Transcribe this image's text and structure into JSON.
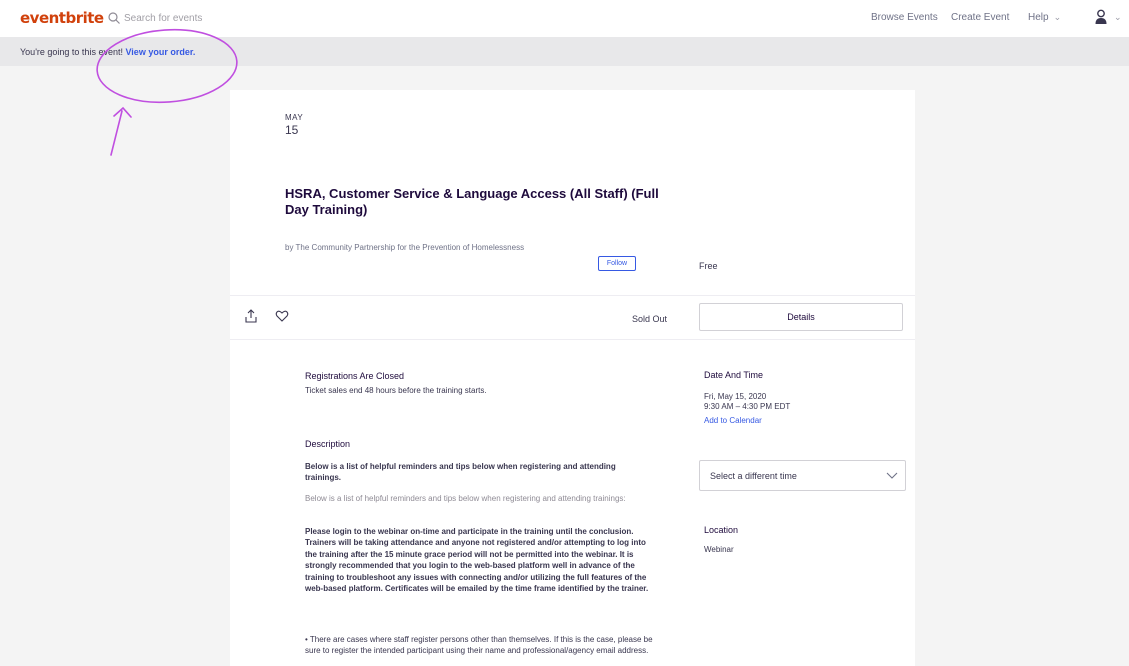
{
  "header": {
    "logo": "eventbrite",
    "search_placeholder": "Search for events",
    "nav": {
      "browse": "Browse Events",
      "create": "Create Event",
      "help": "Help"
    },
    "chevron": "⌄"
  },
  "banner": {
    "text": "You're going to this event! ",
    "link": "View your order."
  },
  "event": {
    "month": "MAY",
    "day": "15",
    "title": "HSRA, Customer Service & Language Access (All Staff) (Full Day Training)",
    "organizer": "by The Community Partnership for the Prevention of Homelessness",
    "follow_label": "Follow",
    "price": "Free"
  },
  "actions": {
    "sold_out": "Sold Out",
    "details_label": "Details"
  },
  "registration": {
    "heading": "Registrations Are Closed",
    "text": "Ticket sales end 48 hours before the training starts."
  },
  "description": {
    "heading": "Description",
    "summary": "Below is a list of helpful reminders and tips below when registering and attending trainings.",
    "summary_repeat": "Below is a list of helpful reminders and tips below when registering and attending trainings:",
    "paragraph": "Please login to the webinar on-time and participate in the training until the conclusion. Trainers will be taking attendance and anyone not registered and/or attempting to log into the training after the 15 minute grace period will not be permitted into the webinar. It is strongly recommended that you login to the web-based platform well in advance of the training to troubleshoot any issues with connecting and/or utilizing the full features of the web-based platform. Certificates will be emailed by the time frame identified by the trainer.",
    "bullet": "• There are cases where staff register persons other than themselves. If this is the case, please be sure to register the intended participant using their name and professional/agency email address."
  },
  "date_time": {
    "heading": "Date And Time",
    "date": "Fri, May 15, 2020",
    "time": "9:30 AM – 4:30 PM EDT",
    "add_calendar": "Add to Calendar",
    "select_label": "Select a different time"
  },
  "location": {
    "heading": "Location",
    "value": "Webinar"
  },
  "colors": {
    "brand": "#d1410c",
    "link": "#3659e3",
    "annotation": "#c04fe0"
  }
}
